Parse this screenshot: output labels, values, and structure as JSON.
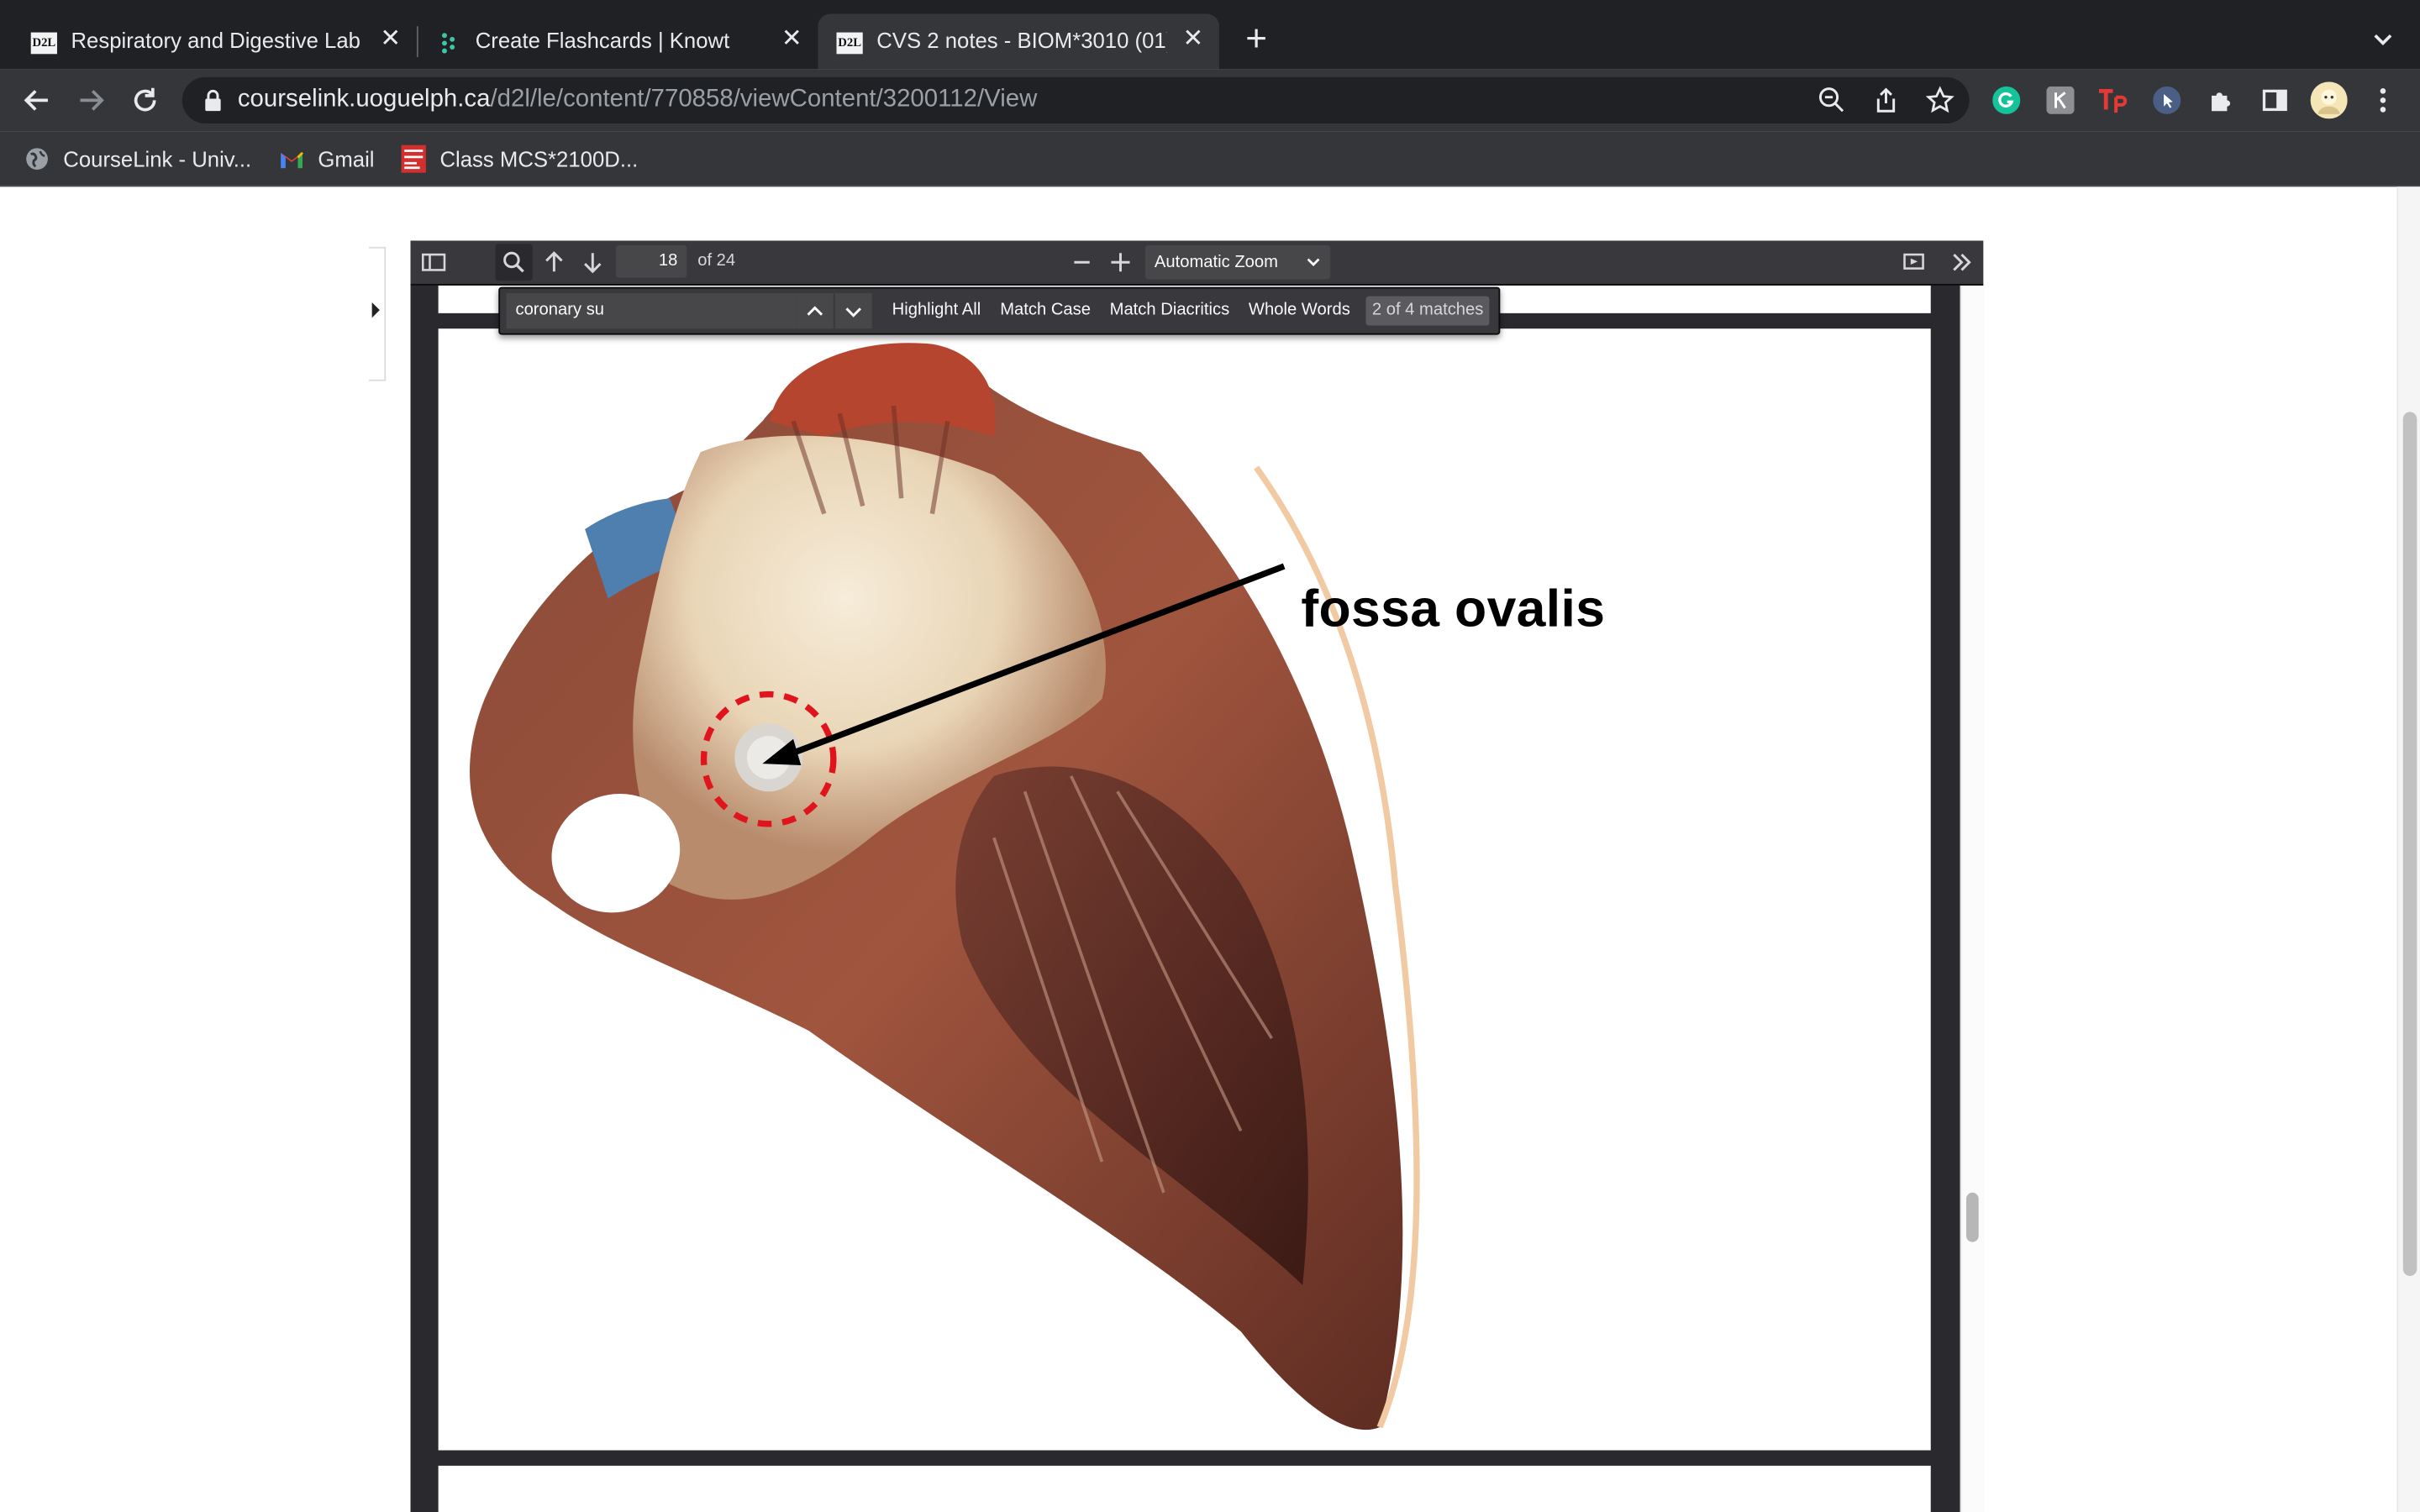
{
  "tabs": [
    {
      "title": "Respiratory and Digestive Lab",
      "icon": "d2l-icon",
      "active": false
    },
    {
      "title": "Create Flashcards | Knowt",
      "icon": "knowt-icon",
      "active": false
    },
    {
      "title": "CVS 2 notes - BIOM*3010 (01)",
      "icon": "d2l-icon",
      "active": true
    }
  ],
  "address": {
    "host": "courselink.uoguelph.ca",
    "path": "/d2l/le/content/770858/viewContent/3200112/View"
  },
  "bookmarks": [
    {
      "label": "CourseLink - Univ...",
      "icon": "globe-icon"
    },
    {
      "label": "Gmail",
      "icon": "gmail-icon"
    },
    {
      "label": "Class MCS*2100D...",
      "icon": "mcgraw-hill-icon"
    }
  ],
  "pdf": {
    "page_number": "18",
    "page_count_label": "of 24",
    "zoom": "Automatic Zoom",
    "find": {
      "query": "coronary su",
      "options": [
        "Highlight All",
        "Match Case",
        "Match Diacritics",
        "Whole Words"
      ],
      "result": "2 of 4 matches"
    },
    "figure_label": "fossa ovalis"
  },
  "colors": {
    "tabstrip": "#202124",
    "toolbar": "#35363a",
    "pdf_toolbar": "#38383d",
    "pdf_bg": "#2a2a2e",
    "annotation_circle": "#e0141c"
  }
}
